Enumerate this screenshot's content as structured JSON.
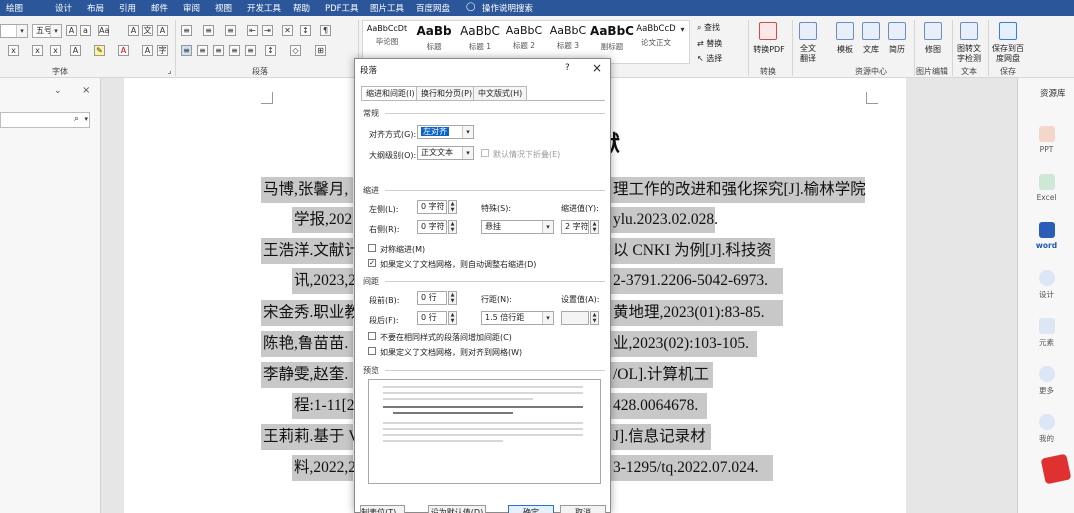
{
  "menubar": {
    "items": [
      "绘图",
      "设计",
      "布局",
      "引用",
      "邮件",
      "审阅",
      "视图",
      "开发工具",
      "帮助",
      "PDF工具",
      "图片工具",
      "百度网盘",
      "操作说明搜索"
    ]
  },
  "ribbon": {
    "font_size": "五号",
    "groups": {
      "font": "字体",
      "paragraph": "段落",
      "pdf": "转换",
      "resources": "资源中心",
      "picture_edit": "图片编辑",
      "text": "文本",
      "save": "保存"
    },
    "styles": [
      {
        "preview": "AaBbCcDt",
        "name": "毕论图"
      },
      {
        "preview": "AaBb",
        "name": "标题"
      },
      {
        "preview": "AaBbC",
        "name": "标题 1"
      },
      {
        "preview": "AaBbC",
        "name": "标题 2"
      },
      {
        "preview": "AaBbC",
        "name": "标题 3"
      },
      {
        "preview": "AaBbC",
        "name": "副标题"
      },
      {
        "preview": "AaBbCcD",
        "name": "论文正文"
      }
    ],
    "find": "查找",
    "replace": "替换",
    "select": "选择",
    "to_pdf": "转换PDF",
    "translate": "全文翻译",
    "template": "模板",
    "library": "文库",
    "resume": "简历",
    "repair": "修图",
    "ocr": "图转文字检测",
    "save_baidu": "保存到百度网盘"
  },
  "document": {
    "title_fragment": "献",
    "lines": [
      "马博,张馨月,",
      "理工作的改进和强化探究[J].榆林学院",
      "学报,202",
      "ylu.2023.02.028.",
      "王浩洋.文献计",
      "以 CNKI 为例[J].科技资",
      "讯,2023,2",
      "2-3791.2206-5042-6973.",
      "宋金秀.职业教",
      "黄地理,2023(01):83-85.",
      "陈艳,鲁苗苗.",
      "业,2023(02):103-105.",
      "李静雯,赵奎.",
      "/OL].计算机工",
      "程:1-11[2",
      "428.0064678.",
      "王莉莉.基于 V",
      "J].信息记录材",
      "料,2022,2",
      "3-1295/tq.2022.07.024."
    ]
  },
  "rightpane": {
    "title": "资源库",
    "items": [
      "PPT",
      "Excel",
      "word",
      "设计",
      "元素",
      "更多",
      "我的"
    ]
  },
  "dialog": {
    "title": "段落",
    "help": "?",
    "close": "×",
    "tabs": [
      "缩进和间距(I)",
      "换行和分页(P)",
      "中文版式(H)"
    ],
    "general": {
      "header": "常规",
      "alignment_label": "对齐方式(G):",
      "alignment_value": "左对齐",
      "outline_label": "大纲级别(O):",
      "outline_value": "正文文本",
      "collapse_label": "默认情况下折叠(E)"
    },
    "indent": {
      "header": "缩进",
      "left_label": "左侧(L):",
      "left_value": "0 字符",
      "right_label": "右侧(R):",
      "right_value": "0 字符",
      "special_label": "特殊(S):",
      "special_value": "悬挂",
      "by_label": "缩进值(Y):",
      "by_value": "2 字符",
      "mirror_label": "对称缩进(M)",
      "auto_label": "如果定义了文档网格，则自动调整右缩进(D)"
    },
    "spacing": {
      "header": "间距",
      "before_label": "段前(B):",
      "before_value": "0 行",
      "after_label": "段后(F):",
      "after_value": "0 行",
      "line_label": "行距(N):",
      "line_value": "1.5 倍行距",
      "at_label": "设置值(A):",
      "at_value": "",
      "no_space_label": "不要在相同样式的段落间增加间距(C)",
      "snap_label": "如果定义了文档网格，则对齐到网格(W)"
    },
    "preview_header": "预览",
    "buttons": [
      "制表位(T)...",
      "设为默认值(D)",
      "确定",
      "取消"
    ]
  }
}
